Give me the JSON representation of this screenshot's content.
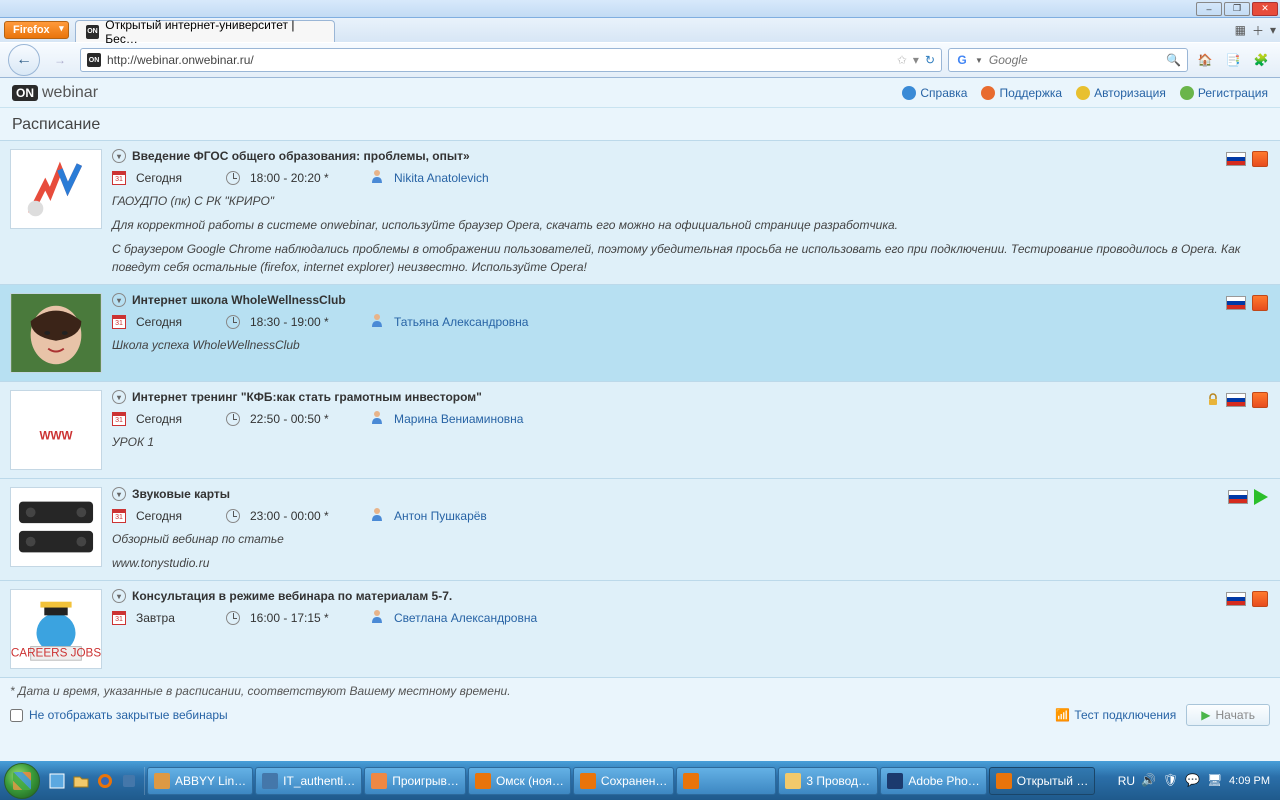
{
  "window": {
    "minimize": "–",
    "maximize": "❐",
    "close": "✕"
  },
  "firefox_button": "Firefox",
  "tab": {
    "title": "Открытый интернет-университет | Бес…"
  },
  "url": "http://webinar.onwebinar.ru/",
  "search": {
    "placeholder": "Google"
  },
  "app": {
    "logo_on": "ON",
    "logo_text": "webinar",
    "links": {
      "help": "Справка",
      "support": "Поддержка",
      "login": "Авторизация",
      "register": "Регистрация"
    }
  },
  "page_title": "Расписание",
  "events": [
    {
      "title": "Введение ФГОС общего образования: проблемы, опыт»",
      "day": "Сегодня",
      "time": "18:00 - 20:20 *",
      "host": "Nikita Anatolevich",
      "org": "ГАОУДПО (пк) С РК \"КРИРО\"",
      "desc": "Для корректной работы в системе onwebinar, используйте браузер Opera, скачать его можно на официальной странице разработчика.",
      "desc2": "С браузером Google Chrome наблюдались проблемы в отображении пользователей, поэтому убедительная просьба не использовать его при подключении. Тестирование проводилось в Opera. Как поведут себя остальные (firefox, internet explorer) неизвестно. Используйте Opera!",
      "badge": "orange",
      "lock": false
    },
    {
      "title": "Интернет школа WholeWellnessClub",
      "day": "Сегодня",
      "time": "18:30 - 19:00 *",
      "host": "Татьяна Александровна",
      "org": "Школа успеха WholeWellnessClub",
      "desc": "",
      "badge": "orange",
      "lock": false
    },
    {
      "title": "Интернет тренинг \"КФБ:как  стать грамотным инвестором\"",
      "day": "Сегодня",
      "time": "22:50 - 00:50 *",
      "host": "Марина Вениаминовна",
      "org": "УРОК 1",
      "desc": "",
      "badge": "orange",
      "lock": true
    },
    {
      "title": "Звуковые карты",
      "day": "Сегодня",
      "time": "23:00 - 00:00 *",
      "host": "Антон Пушкарёв",
      "org": "Обзорный вебинар по статье",
      "desc": "www.tonystudio.ru",
      "badge": "green",
      "lock": false
    },
    {
      "title": "Консультация в режиме вебинара по материалам 5-7.",
      "day": "Завтра",
      "time": "16:00 - 17:15 *",
      "host": "Светлана Александровна",
      "org": "",
      "desc": "",
      "badge": "orange",
      "lock": false
    }
  ],
  "footnote": "* Дата и время, указанные в расписании, соответствуют Вашему местному времени.",
  "hide_closed": "Не отображать закрытые вебинары",
  "test_conn": "Тест подключения",
  "start_btn": "Начать",
  "taskbar": {
    "items": [
      "ABBYY Lin…",
      "IT_authenti…",
      "Проигрыв…",
      "Омск (ноя…",
      "Сохранен…",
      "",
      "3 Провод…",
      "Adobe Pho…",
      "Открытый …"
    ],
    "lang": "RU",
    "clock": "4:09 PM"
  }
}
